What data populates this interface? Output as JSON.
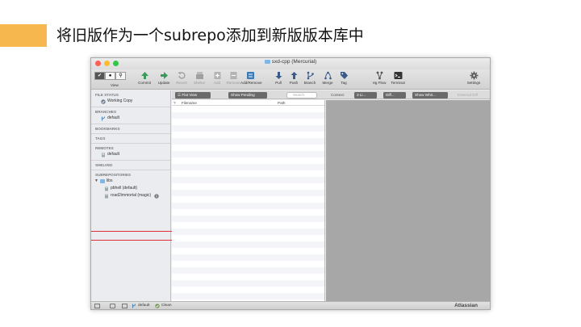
{
  "slide": {
    "title": "将旧版作为一个subrepo添加到新版版本库中"
  },
  "window": {
    "title": "sxd-cpp (Mercurial)"
  },
  "toolbar": {
    "view_label": "View",
    "items": [
      {
        "label": "Commit",
        "icon": "commit-icon",
        "color": "#3a9a5a"
      },
      {
        "label": "Update",
        "icon": "update-icon",
        "color": "#3a9a5a"
      },
      {
        "label": "Revert",
        "icon": "revert-icon",
        "color": "#a0a0a0"
      },
      {
        "label": "Shelve",
        "icon": "shelve-icon",
        "color": "#a0a0a0"
      },
      {
        "label": "Add",
        "icon": "add-icon",
        "color": "#a0a0a0"
      },
      {
        "label": "Remove",
        "icon": "remove-icon",
        "color": "#a0a0a0"
      },
      {
        "label": "Add/Remove",
        "icon": "add-remove-icon",
        "color": "#3a7ab8"
      },
      {
        "label": "Pull",
        "icon": "pull-icon",
        "color": "#3a5a8a"
      },
      {
        "label": "Push",
        "icon": "push-icon",
        "color": "#3a5a8a"
      },
      {
        "label": "Branch",
        "icon": "branch-icon",
        "color": "#3a5a8a"
      },
      {
        "label": "Merge",
        "icon": "merge-icon",
        "color": "#3a5a8a"
      },
      {
        "label": "Tag",
        "icon": "tag-icon",
        "color": "#3a5a8a"
      },
      {
        "label": "Hg Flow",
        "icon": "hg-flow-icon",
        "color": "#555555"
      },
      {
        "label": "Terminal",
        "icon": "terminal-icon",
        "color": "#333333"
      },
      {
        "label": "Settings",
        "icon": "gear-icon",
        "color": "#555555"
      }
    ]
  },
  "sidebar": {
    "file_status": {
      "heading": "FILE STATUS",
      "item": "Working Copy"
    },
    "branches": {
      "heading": "BRANCHES",
      "item": "default"
    },
    "bookmarks": {
      "heading": "BOOKMARKS"
    },
    "tags": {
      "heading": "TAGS"
    },
    "remotes": {
      "heading": "REMOTES",
      "item": "default"
    },
    "shelved": {
      "heading": "SHELVED"
    },
    "subrepositories": {
      "heading": "SUBREPOSITORIES",
      "folder": "libs",
      "items": [
        {
          "label": "pbhell (default)"
        },
        {
          "label": "road2immortal (magic)"
        }
      ]
    }
  },
  "filterbar": {
    "view_mode": "Flat View",
    "pending": "Show Pending",
    "search_placeholder": "Search",
    "context_label": "Context:",
    "context_value": "3 Li...",
    "diff_value": "Diff...",
    "whitespace_value": "Show Whit...",
    "external_diff": "External Diff"
  },
  "filelist": {
    "col_filename": "Filename",
    "col_path": "Path",
    "col_sort": "?"
  },
  "statusbar": {
    "branch": "default",
    "status": "Clean",
    "brand": "Atlassian"
  }
}
